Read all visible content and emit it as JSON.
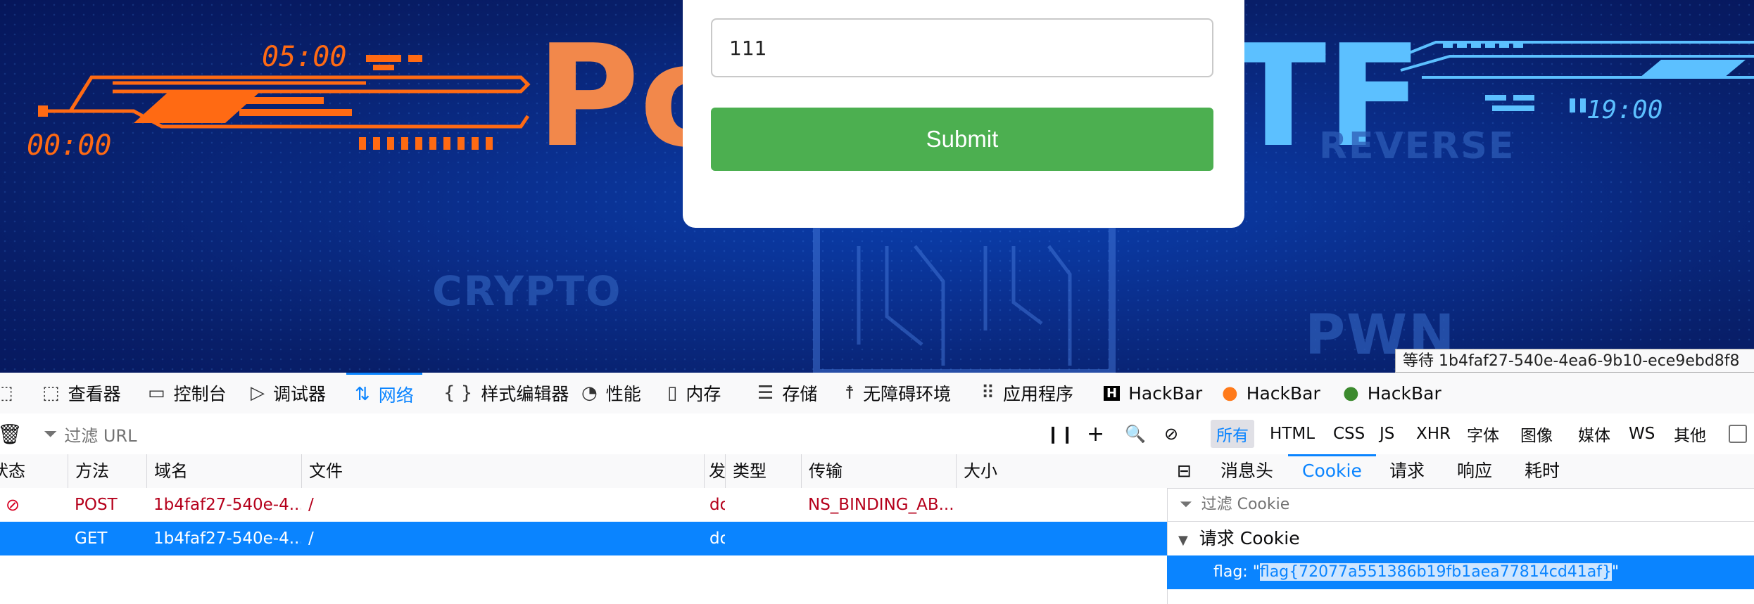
{
  "banner": {
    "title_left": "Po",
    "title_right": "TF",
    "words": {
      "reverse": "REVERSE",
      "crypto": "CRYPTO",
      "pwn": "PWN"
    },
    "time_left_top": "05:00",
    "time_left_bottom": "00:00",
    "time_right": "19:00",
    "colors": {
      "orange": "#ff6a13",
      "blue": "#5cc0ff"
    }
  },
  "form": {
    "input_value": "111",
    "submit_label": "Submit"
  },
  "status_tooltip": "等待 1b4faf27-540e-4ea6-9b10-ece9ebd8f8",
  "devtools": {
    "tabs": [
      {
        "label": "查看器",
        "icon": "inspector-icon"
      },
      {
        "label": "控制台",
        "icon": "console-icon"
      },
      {
        "label": "调试器",
        "icon": "debugger-icon"
      },
      {
        "label": "网络",
        "icon": "network-icon"
      },
      {
        "label": "样式编辑器",
        "icon": "style-editor-icon"
      },
      {
        "label": "性能",
        "icon": "performance-icon"
      },
      {
        "label": "内存",
        "icon": "memory-icon"
      },
      {
        "label": "存储",
        "icon": "storage-icon"
      },
      {
        "label": "无障碍环境",
        "icon": "accessibility-icon"
      },
      {
        "label": "应用程序",
        "icon": "application-icon"
      },
      {
        "label": "HackBar",
        "icon": "hackbar-icon"
      },
      {
        "label": "HackBar",
        "icon": "hackbar-firefox-icon"
      },
      {
        "label": "HackBar",
        "icon": "hackbar-green-icon"
      }
    ],
    "filter_placeholder": "过滤 URL",
    "type_filters": [
      "所有",
      "HTML",
      "CSS",
      "JS",
      "XHR",
      "字体",
      "图像",
      "媒体",
      "WS",
      "其他"
    ],
    "columns": [
      "状态",
      "方法",
      "域名",
      "文件",
      "发",
      "类型",
      "传输",
      "大小"
    ],
    "requests": [
      {
        "method": "POST",
        "domain": "1b4faf27-540e-4...",
        "file": "/",
        "initiator": "do",
        "type": "",
        "transfer": "NS_BINDING_AB...",
        "size": ""
      },
      {
        "method": "GET",
        "domain": "1b4faf27-540e-4...",
        "file": "/",
        "initiator": "do",
        "type": "",
        "transfer": "",
        "size": ""
      }
    ],
    "side_tabs": [
      "消息头",
      "Cookie",
      "请求",
      "响应",
      "耗时"
    ],
    "cookie_filter_placeholder": "过滤 Cookie",
    "section_title": "请求 Cookie",
    "cookie": {
      "name": "flag:",
      "value": "flag{72077a551386b19fb1aea77814cd41af}"
    },
    "accent": "#0a84ff"
  }
}
